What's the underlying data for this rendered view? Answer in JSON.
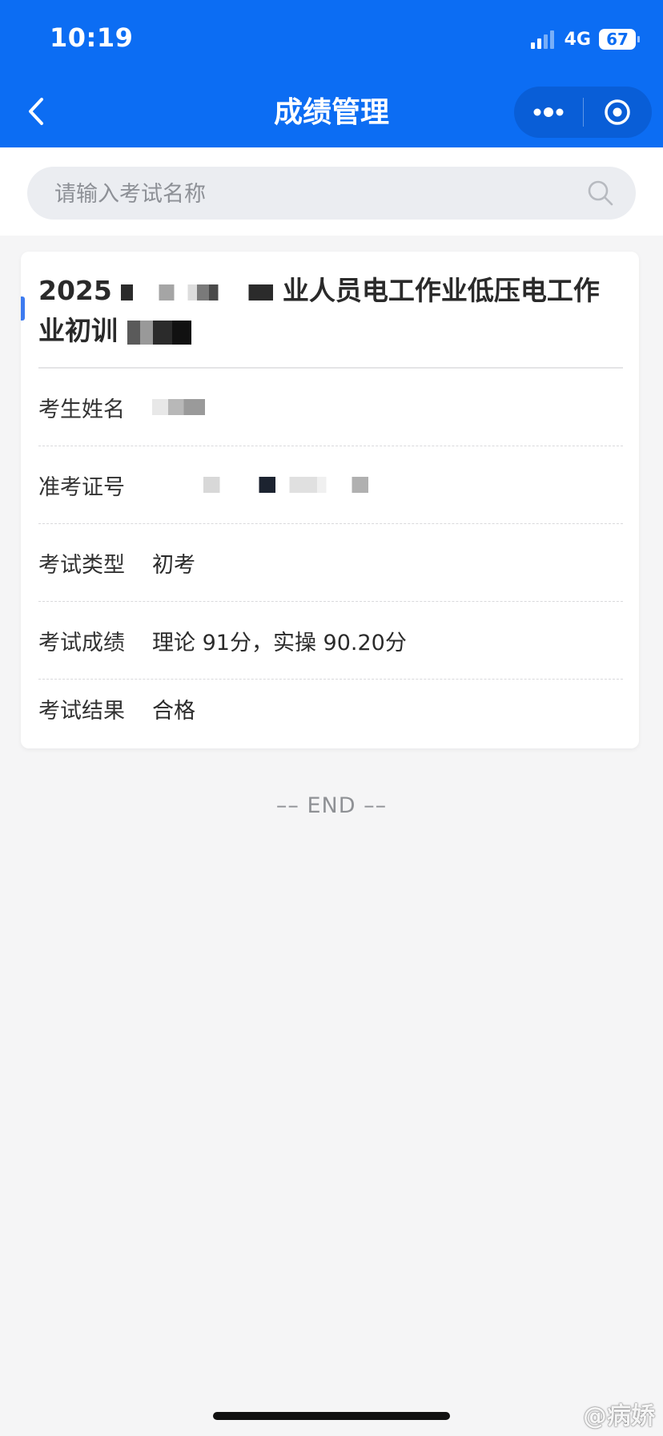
{
  "status_bar": {
    "time": "10:19",
    "network": "4G",
    "battery": "67"
  },
  "nav": {
    "title": "成绩管理",
    "back_icon": "chevron-left-icon",
    "more_icon": "more-dots-icon",
    "close_icon": "target-circle-icon"
  },
  "search": {
    "placeholder": "请输入考试名称",
    "icon": "search-icon"
  },
  "exam": {
    "title_start": "2025",
    "title_mid": "业人员电工作业低压电工作",
    "title_end": "业初训",
    "fields": [
      {
        "label": "考生姓名",
        "value": ""
      },
      {
        "label": "准考证号",
        "value": ""
      },
      {
        "label": "考试类型",
        "value": "初考"
      },
      {
        "label": "考试成绩",
        "value": "理论 91分，实操 90.20分"
      },
      {
        "label": "考试结果",
        "value": "合格"
      }
    ]
  },
  "end_label": "–– END ––",
  "watermark": "@病娇",
  "colors": {
    "brand": "#0c6df3",
    "accent": "#3d7bf0",
    "background": "#f5f5f6"
  }
}
